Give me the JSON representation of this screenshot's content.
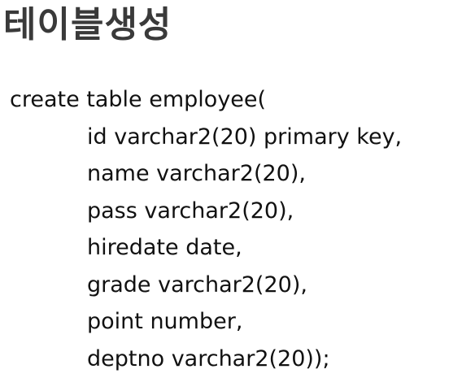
{
  "slide": {
    "title": "테이블생성",
    "code_lines": [
      "create table employee(",
      "id varchar2(20) primary key,",
      "name varchar2(20),",
      "pass varchar2(20),",
      "hiredate date,",
      "grade varchar2(20),",
      "point number,",
      "deptno varchar2(20));"
    ]
  }
}
